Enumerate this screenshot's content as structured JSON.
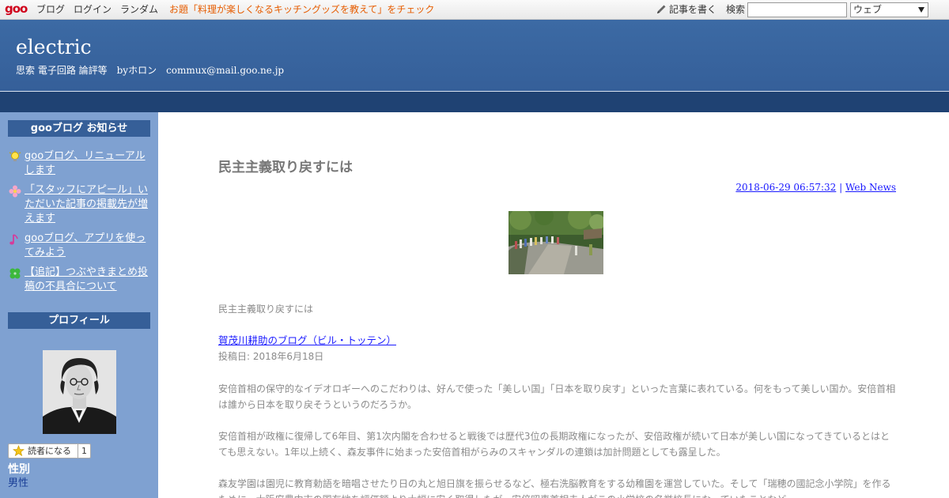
{
  "topbar": {
    "logo": "goo",
    "nav_blog": "ブログ",
    "nav_login": "ログイン",
    "nav_random": "ランダム",
    "promo": "お題「料理が楽しくなるキッチングッズを教えて」をチェック",
    "write_label": "記事を書く",
    "search_label": "検索",
    "search_value": "",
    "search_scope": "ウェブ"
  },
  "header": {
    "title": "electric",
    "description": "思索 電子回路 論評等　byホロン　commux@mail.goo.ne.jp"
  },
  "sidebar": {
    "notice_heading": "gooブログ お知らせ",
    "notices": [
      {
        "label": "gooブログ、リニューアルします",
        "icon": "lightbulb-icon"
      },
      {
        "label": "「スタッフにアピール」いただいた記事の掲載先が増えます",
        "icon": "flower-icon"
      },
      {
        "label": "gooブログ、アプリを使ってみよう",
        "icon": "music-note-icon"
      },
      {
        "label": "【追記】つぶやきまとめ投稿の不具合について",
        "icon": "clover-icon"
      }
    ],
    "profile_heading": "プロフィール",
    "follow_label": "読者になる",
    "follow_count": "1",
    "gender_label": "性別",
    "gender_value": "男性"
  },
  "post": {
    "title": "民主主義取り戻すには",
    "datetime": "2018-06-29 06:57:32",
    "separator": "|",
    "category": "Web News",
    "lead": "民主主義取り戻すには",
    "source_link": "賀茂川耕助のブログ（ビル・トッテン）",
    "posted_date": "投稿日: 2018年6月18日",
    "para1": "安倍首相の保守的なイデオロギーへのこだわりは、好んで使った「美しい国」「日本を取り戻す」といった言葉に表れている。何をもって美しい国か。安倍首相は誰から日本を取り戻そうというのだろうか。",
    "para2": "安倍首相が政権に復帰して6年目、第1次内閣を合わせると戦後では歴代3位の長期政権になったが、安倍政権が続いて日本が美しい国になってきているとはとても思えない。1年以上続く、森友事件に始まった安倍首相がらみのスキャンダルの連鎖は加計問題としても露呈した。",
    "para3": "森友学園は園児に教育勅語を暗唱させたり日の丸と旭日旗を振らせるなど、極右洗脳教育をする幼稚園を運営していた。そして「瑞穂の國記念小学院」を作るために、大阪府豊中市の国有地を評価額より大幅に安く取得したが、安倍昭恵首相夫人がこの小学校の名誉校長になっていたことなど"
  },
  "colors": {
    "header_blue": "#3c6aa4",
    "band_navy": "#1f4273",
    "sidebar_blue": "#7fa1d1",
    "sidebar_heading": "#365f98",
    "link_blue": "#1a1aff",
    "promo_orange": "#e65c00",
    "logo_red": "#d0021b"
  }
}
